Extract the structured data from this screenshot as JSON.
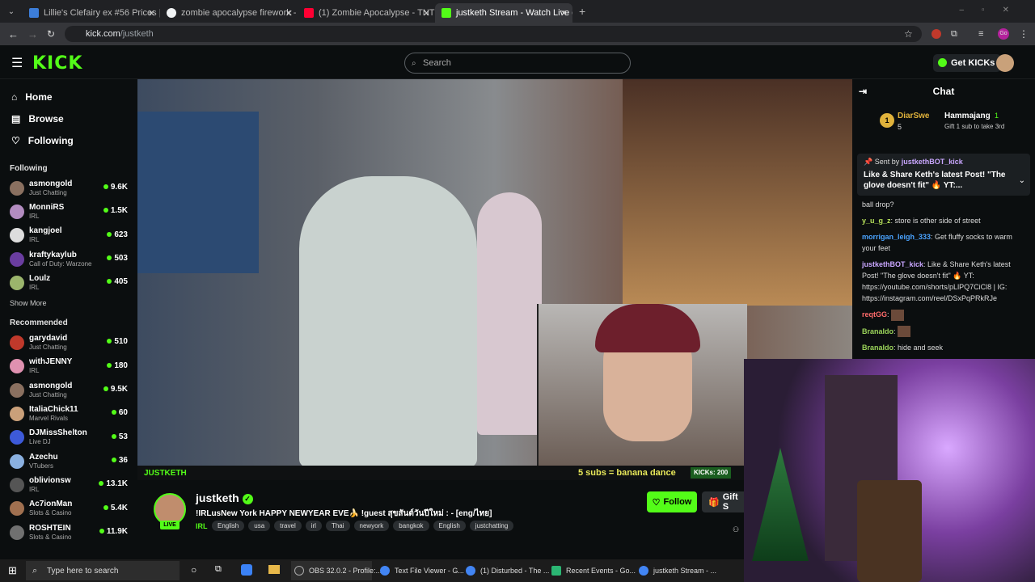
{
  "browser": {
    "tabs": [
      {
        "label": "Lillie's Clefairy ex #56 Prices | P",
        "color": "#3c7dd9"
      },
      {
        "label": "zombie apocalypse firework - G",
        "color": "#f1f3f4"
      },
      {
        "label": "(1) Zombie Apocalypse - TNT F",
        "color": "#ff0033"
      },
      {
        "label": "justketh Stream - Watch Live o",
        "color": "#53fc18"
      }
    ],
    "url_host": "kick.com",
    "url_path": "/justketh"
  },
  "header": {
    "logo": "KICK",
    "search_placeholder": "Search",
    "get_kicks": "Get KICKs"
  },
  "sidebar": {
    "nav": [
      {
        "label": "Home",
        "icon": "home-icon"
      },
      {
        "label": "Browse",
        "icon": "browse-icon"
      },
      {
        "label": "Following",
        "icon": "heart-icon"
      }
    ],
    "following_title": "Following",
    "following": [
      {
        "name": "asmongold",
        "cat": "Just Chatting",
        "viewers": "9.6K",
        "color": "#8a7060"
      },
      {
        "name": "MonniRS",
        "cat": "IRL",
        "viewers": "1.5K",
        "color": "#b38cc0"
      },
      {
        "name": "kangjoel",
        "cat": "IRL",
        "viewers": "623",
        "color": "#ddd"
      },
      {
        "name": "kraftykaylub",
        "cat": "Call of Duty: Warzone",
        "viewers": "503",
        "color": "#6a3da0"
      },
      {
        "name": "Loulz",
        "cat": "IRL",
        "viewers": "405",
        "color": "#9bb56c"
      }
    ],
    "show_more": "Show More",
    "recommended_title": "Recommended",
    "recommended": [
      {
        "name": "garydavid",
        "cat": "Just Chatting",
        "viewers": "510",
        "color": "#c0392b"
      },
      {
        "name": "withJENNY",
        "cat": "IRL",
        "viewers": "180",
        "color": "#e091b0"
      },
      {
        "name": "asmongold",
        "cat": "Just Chatting",
        "viewers": "9.5K",
        "color": "#8a7060"
      },
      {
        "name": "ItaliaChick11",
        "cat": "Marvel Rivals",
        "viewers": "60",
        "color": "#caa07a"
      },
      {
        "name": "DJMissShelton",
        "cat": "Live DJ",
        "viewers": "53",
        "color": "#3d5ad9"
      },
      {
        "name": "Azechu",
        "cat": "VTubers",
        "viewers": "36",
        "color": "#8ab0e0"
      },
      {
        "name": "oblivionsw",
        "cat": "IRL",
        "viewers": "13.1K",
        "color": "#555"
      },
      {
        "name": "Ac7ionMan",
        "cat": "Slots & Casino",
        "viewers": "5.4K",
        "color": "#a07050"
      },
      {
        "name": "ROSHTEIN",
        "cat": "Slots & Casino",
        "viewers": "11.9K",
        "color": "#707070"
      }
    ]
  },
  "overlay": {
    "logo": "JUSTKETH",
    "goal": "5 subs = banana dance",
    "kicks_label": "KICKs:",
    "kicks_value": "200"
  },
  "stream": {
    "name": "justketh",
    "title": "!IRLusNew York HAPPY NEWYEAR EVE🍌 !guest สุขสันต์วันปีใหม่ : - [eng/ไทย]",
    "category": "IRL",
    "tags": [
      "English",
      "usa",
      "travel",
      "irl",
      "Thai",
      "newyork",
      "bangkok",
      "English",
      "justchatting"
    ],
    "live_badge": "LIVE",
    "follow": "Follow",
    "gift": "Gift S"
  },
  "chat": {
    "title": "Chat",
    "leader1_name": "DiarSwe",
    "leader1_count": "5",
    "leader2_name": "Hammajang",
    "leader2_count": "1",
    "leader2_sub": "Gift 1 sub to take 3rd",
    "pinned_by": "Sent by",
    "pinned_user": "justkethBOT_kick",
    "pinned_text": "Like & Share Keth's latest Post! \"The glove doesn't fit\" 🔥 YT:...",
    "messages": [
      {
        "user": "",
        "text": "ball drop?",
        "color": "#ddd"
      },
      {
        "user": "y_u_g_z",
        "text": ": store is other side of street",
        "color": "#b6e05a"
      },
      {
        "user": "morrigan_leigh_333",
        "text": ": Get fluffy socks to warm your feet",
        "color": "#4aa3ff"
      },
      {
        "user": "justkethBOT_kick",
        "text": ": Like & Share Keth's latest Post! \"The glove doesn't fit\" 🔥 YT: https://youtube.com/shorts/pLlPQ7CiCl8 | IG: https://instagram.com/reel/DSxPqPRkRJe",
        "color": "#c9a6ff"
      },
      {
        "user": "reqtGG",
        "text": ":",
        "color": "#ff6b6b"
      },
      {
        "user": "Branaldo",
        "text": ":",
        "color": "#9bd45a"
      },
      {
        "user": "Branaldo",
        "text": ": hide and seek",
        "color": "#9bd45a"
      }
    ]
  },
  "taskbar": {
    "search": "Type here to search",
    "apps": [
      {
        "label": "OBS 32.0.2 - Profile:...",
        "color": "#333"
      },
      {
        "label": "Text File Viewer - G...",
        "color": "#4285f4"
      },
      {
        "label": "(1) Disturbed - The ...",
        "color": "#4285f4"
      },
      {
        "label": "Recent Events - Go...",
        "color": "#2bb673"
      },
      {
        "label": "justketh Stream - ...",
        "color": "#4285f4"
      }
    ]
  }
}
